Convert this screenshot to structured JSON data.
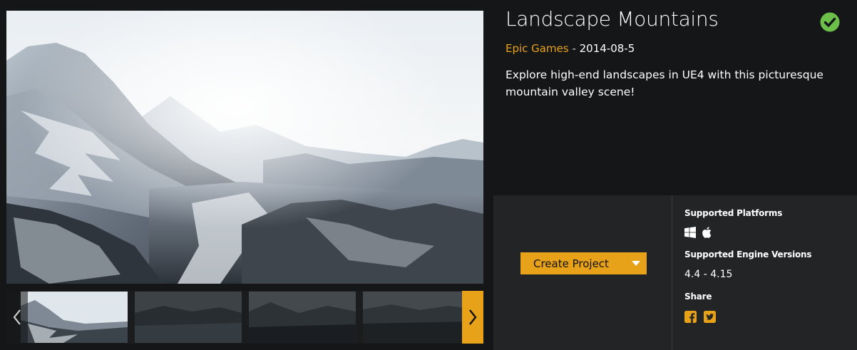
{
  "product": {
    "title": "Landscape Mountains",
    "publisher": "Epic Games",
    "separator": "-",
    "date": "2014-08-5",
    "description": "Explore high-end landscapes in UE4 with this picturesque mountain valley scene!",
    "owned_icon": "check-circle-icon"
  },
  "actions": {
    "create_project_label": "Create Project",
    "dropdown_icon": "caret-down-icon"
  },
  "details": {
    "platforms_heading": "Supported Platforms",
    "platform_icons": [
      "windows-icon",
      "apple-icon"
    ],
    "engine_heading": "Supported Engine Versions",
    "engine_versions": "4.4 - 4.15",
    "share_heading": "Share",
    "share_icons": [
      "facebook-icon",
      "twitter-icon"
    ]
  },
  "gallery": {
    "prev_icon": "chevron-left-icon",
    "next_icon": "chevron-right-icon",
    "thumbnail_count": 4,
    "selected_index": 0
  },
  "colors": {
    "accent": "#e7a21a",
    "background": "#151618",
    "panel": "#232426",
    "check": "#6cc04a"
  }
}
